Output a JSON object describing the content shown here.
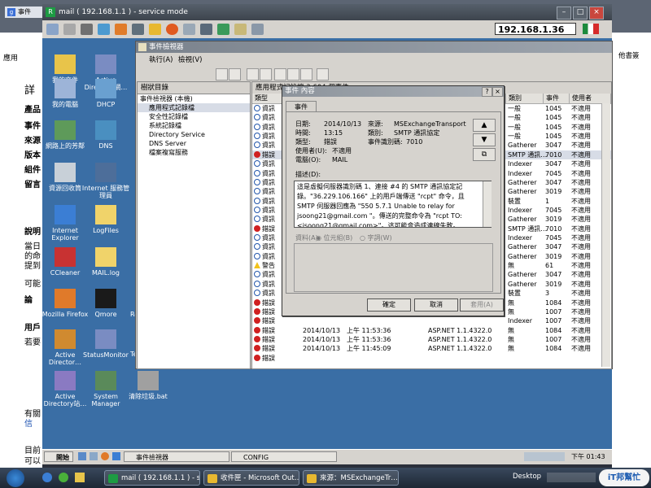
{
  "outer": {
    "tab_label": "事件",
    "page_labels": [
      "詳",
      "產品",
      "事件",
      "來源",
      "版本",
      "組件",
      "留言",
      "說明",
      "當日",
      "的命",
      "提到",
      "可能",
      "論",
      "用戶",
      "若要",
      "有關",
      "信",
      "目前",
      "可以"
    ],
    "bookmarks_label": "應用",
    "right_label": "他書簽"
  },
  "remote": {
    "title": "mail ( 192.168.1.1 ) - service mode",
    "address": "192.168.1.36",
    "icon_names": [
      "monitor-icon",
      "gear-icon",
      "tools-icon",
      "refresh-icon",
      "user-icon",
      "camera-icon",
      "lock-icon",
      "alert-icon",
      "fullscreen-icon",
      "monitor2-icon",
      "transfer-icon",
      "note-icon",
      "window-icon"
    ]
  },
  "desktop": {
    "icons": [
      {
        "label": "我的文件",
        "name": "my-documents-icon",
        "color": "#e8c44a"
      },
      {
        "label": "Active Directory網…",
        "name": "active-directory-icon",
        "color": "#7a8cc2"
      },
      {
        "label": "我的電腦",
        "name": "my-computer-icon",
        "color": "#9db4d8"
      },
      {
        "label": "DHCP",
        "name": "dhcp-icon",
        "color": "#6aa0d0"
      },
      {
        "label": "網路上的芳鄰",
        "name": "network-places-icon",
        "color": "#5e9a5a"
      },
      {
        "label": "DNS",
        "name": "dns-icon",
        "color": "#4a8fc0"
      },
      {
        "label": "資源回收筒",
        "name": "recycle-bin-icon",
        "color": "#c8d0d8"
      },
      {
        "label": "Internet 服務管理員",
        "name": "iis-manager-icon",
        "color": "#4d6e9a"
      },
      {
        "label": "Internet Explorer",
        "name": "ie-icon",
        "color": "#3b7ed4"
      },
      {
        "label": "LogFiles",
        "name": "folder-icon",
        "color": "#f0d36a"
      },
      {
        "label": "CCleaner",
        "name": "ccleaner-icon",
        "color": "#c83232"
      },
      {
        "label": "MAIL.log",
        "name": "log-file-icon",
        "color": "#f0d36a"
      },
      {
        "label": "Mozilla Firefox",
        "name": "firefox-icon",
        "color": "#e07a2a"
      },
      {
        "label": "Qmore",
        "name": "qmore-icon",
        "color": "#1a1a1a"
      },
      {
        "label": "Active Director…",
        "name": "active-director-icon",
        "color": "#d08a30"
      },
      {
        "label": "StatusMonitor",
        "name": "status-monitor-icon",
        "color": "#7a8cc2"
      },
      {
        "label": "Active Directory站…",
        "name": "ad-sites-icon",
        "color": "#8a7ac2"
      },
      {
        "label": "System Manager",
        "name": "system-manager-icon",
        "color": "#5a8a5a"
      },
      {
        "label": "清除垃圾.bat",
        "name": "bat-file-icon",
        "color": "#a0a0a0"
      }
    ],
    "edge_labels": [
      "Re",
      "Te"
    ]
  },
  "event_viewer": {
    "title": "事件檢視器",
    "menu": [
      "執行(A)",
      "檢視(V)"
    ],
    "tree_header": "樹狀目錄",
    "tree": [
      "事件檢視器 (本機)",
      "應用程式記錄檔",
      "安全性記錄檔",
      "系統記錄檔",
      "Directory Service",
      "DNS Server",
      "檔案複寫服務"
    ],
    "list_bar": "應用程式記錄檔  3,604 個事件",
    "columns": [
      "類型",
      "日期",
      "時間",
      "來源",
      "類別",
      "事件",
      "使用者"
    ],
    "rows": [
      {
        "type": "資訊",
        "t": "info",
        "cat": "一般",
        "ev": "1045",
        "user": "不適用"
      },
      {
        "type": "資訊",
        "t": "info",
        "cat": "一般",
        "ev": "1045",
        "user": "不適用"
      },
      {
        "type": "資訊",
        "t": "info",
        "cat": "一般",
        "ev": "1045",
        "user": "不適用"
      },
      {
        "type": "資訊",
        "t": "info",
        "cat": "一般",
        "ev": "1045",
        "user": "不適用"
      },
      {
        "type": "資訊",
        "t": "info",
        "cat": "Gatherer",
        "ev": "3047",
        "user": "不適用"
      },
      {
        "type": "錯誤",
        "t": "err",
        "cat": "SMTP 通訊…",
        "ev": "7010",
        "user": "不適用",
        "sel": true
      },
      {
        "type": "資訊",
        "t": "info",
        "cat": "Indexer",
        "ev": "3047",
        "user": "不適用"
      },
      {
        "type": "資訊",
        "t": "info",
        "cat": "Indexer",
        "ev": "7045",
        "user": "不適用"
      },
      {
        "type": "資訊",
        "t": "info",
        "cat": "Gatherer",
        "ev": "3047",
        "user": "不適用"
      },
      {
        "type": "資訊",
        "t": "info",
        "cat": "Gatherer",
        "ev": "3019",
        "user": "不適用"
      },
      {
        "type": "資訊",
        "t": "info",
        "cat": "裝置",
        "ev": "1",
        "user": "不適用"
      },
      {
        "type": "資訊",
        "t": "info",
        "cat": "Indexer",
        "ev": "7045",
        "user": "不適用"
      },
      {
        "type": "資訊",
        "t": "info",
        "cat": "Gatherer",
        "ev": "3019",
        "user": "不適用"
      },
      {
        "type": "錯誤",
        "t": "err",
        "cat": "SMTP 通訊…",
        "ev": "7010",
        "user": "不適用"
      },
      {
        "type": "資訊",
        "t": "info",
        "cat": "Indexer",
        "ev": "7045",
        "user": "不適用"
      },
      {
        "type": "資訊",
        "t": "info",
        "cat": "Gatherer",
        "ev": "3047",
        "user": "不適用"
      },
      {
        "type": "資訊",
        "t": "info",
        "cat": "Gatherer",
        "ev": "3019",
        "user": "不適用"
      },
      {
        "type": "警告",
        "t": "warn",
        "cat": "無",
        "ev": "61",
        "user": "不適用"
      },
      {
        "type": "資訊",
        "t": "info",
        "cat": "Gatherer",
        "ev": "3047",
        "user": "不適用"
      },
      {
        "type": "資訊",
        "t": "info",
        "cat": "Gatherer",
        "ev": "3019",
        "user": "不適用"
      },
      {
        "type": "資訊",
        "t": "info",
        "cat": "裝置",
        "ev": "3",
        "user": "不適用"
      },
      {
        "type": "錯誤",
        "t": "err",
        "cat": "無",
        "ev": "1084",
        "user": "不適用"
      },
      {
        "type": "錯誤",
        "t": "err",
        "cat": "無",
        "ev": "1007",
        "user": "不適用"
      },
      {
        "type": "錯誤",
        "t": "err",
        "cat": "Indexer",
        "ev": "1007",
        "user": "不適用"
      },
      {
        "type": "錯誤",
        "t": "err",
        "date": "2014/10/13",
        "time": "上午 11:53:36",
        "src": "ASP.NET 1.1.4322.0",
        "cat": "無",
        "ev": "1084",
        "user": "不適用"
      },
      {
        "type": "錯誤",
        "t": "err",
        "date": "2014/10/13",
        "time": "上午 11:53:36",
        "src": "ASP.NET 1.1.4322.0",
        "cat": "無",
        "ev": "1007",
        "user": "不適用"
      },
      {
        "type": "錯誤",
        "t": "err",
        "date": "2014/10/13",
        "time": "上午 11:45:09",
        "src": "ASP.NET 1.1.4322.0",
        "cat": "無",
        "ev": "1084",
        "user": "不適用"
      },
      {
        "type": "錯誤",
        "t": "err",
        "date": "",
        "time": "",
        "src": "",
        "cat": "",
        "ev": "",
        "user": ""
      }
    ]
  },
  "dialog": {
    "title": "事件 內容",
    "tab": "事件",
    "date_label": "日期:",
    "date": "2014/10/13",
    "source_label": "來源:",
    "source": "MSExchangeTransport",
    "time_label": "時間:",
    "time": "13:15",
    "category_label": "類別:",
    "category": "SMTP 通訊協定",
    "type_label": "類型:",
    "type": "錯誤",
    "event_id_label": "事件識別碼:",
    "event_id": "7010",
    "user_label": "使用者(U):",
    "user": "不適用",
    "computer_label": "電腦(O):",
    "computer": "MAIL",
    "desc_label": "描述(D):",
    "description": "這是虛擬伺服器識別碼 1、連接 #4 的 SMTP 通訊協定記錄。\"36.229.106.166\" 上的用戶端傳送 \"rcpt\" 命令，且 SMTP 伺服器回應為 \"550 5.7.1 Unable to relay for jsoong21@gmail.com \"。傳送的完整命令為 \"rcpt TO:<jsoong21@gmail.com>\"。這可能會造成連線失敗。",
    "data_label": "資料(A):",
    "radio_byte": "位元組(B)",
    "radio_word": "字詞(W)",
    "ok": "確定",
    "cancel": "取消",
    "apply": "套用(A)"
  },
  "remote_taskbar": {
    "start": "開始",
    "tasks": [
      "事件檢視器",
      "CONFIG"
    ],
    "clock": "下午 01:43"
  },
  "win_taskbar": {
    "tasks": [
      "mail ( 192.168.1.1 ) - s…",
      "收件匣 - Microsoft Out…",
      "來源：MSExchangeTr…"
    ],
    "desktop_label": "Desktop",
    "watermark": "iT邦幫忙"
  }
}
